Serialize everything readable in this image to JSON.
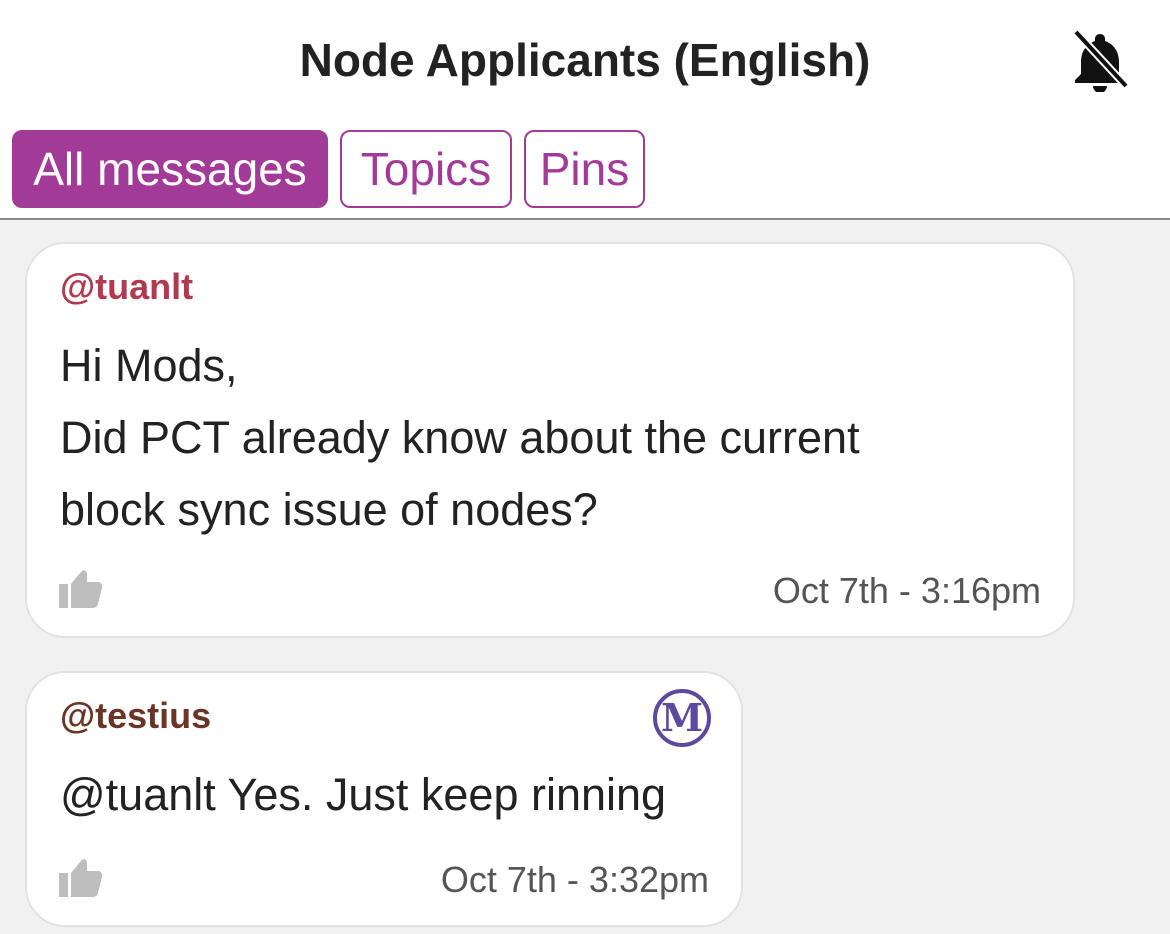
{
  "header": {
    "title": "Node Applicants (English)",
    "notification_icon": "bell-slash-icon"
  },
  "tabs": [
    {
      "label": "All messages",
      "active": true
    },
    {
      "label": "Topics",
      "active": false
    },
    {
      "label": "Pins",
      "active": false
    }
  ],
  "colors": {
    "accent": "#a23a98",
    "author1": "#b03a50",
    "author2": "#6b3525",
    "mod_badge": "#5b4a9e"
  },
  "messages": [
    {
      "author": "@tuanlt",
      "lines": [
        "Hi Mods,",
        "Did PCT already know about the current",
        "block sync issue of nodes?"
      ],
      "timestamp": "Oct 7th - 3:16pm",
      "like_icon": "thumbs-up-icon"
    },
    {
      "author": "@testius",
      "badge": "M",
      "lines": [
        "@tuanlt Yes. Just keep rinning"
      ],
      "timestamp": "Oct 7th - 3:32pm",
      "like_icon": "thumbs-up-icon"
    }
  ]
}
